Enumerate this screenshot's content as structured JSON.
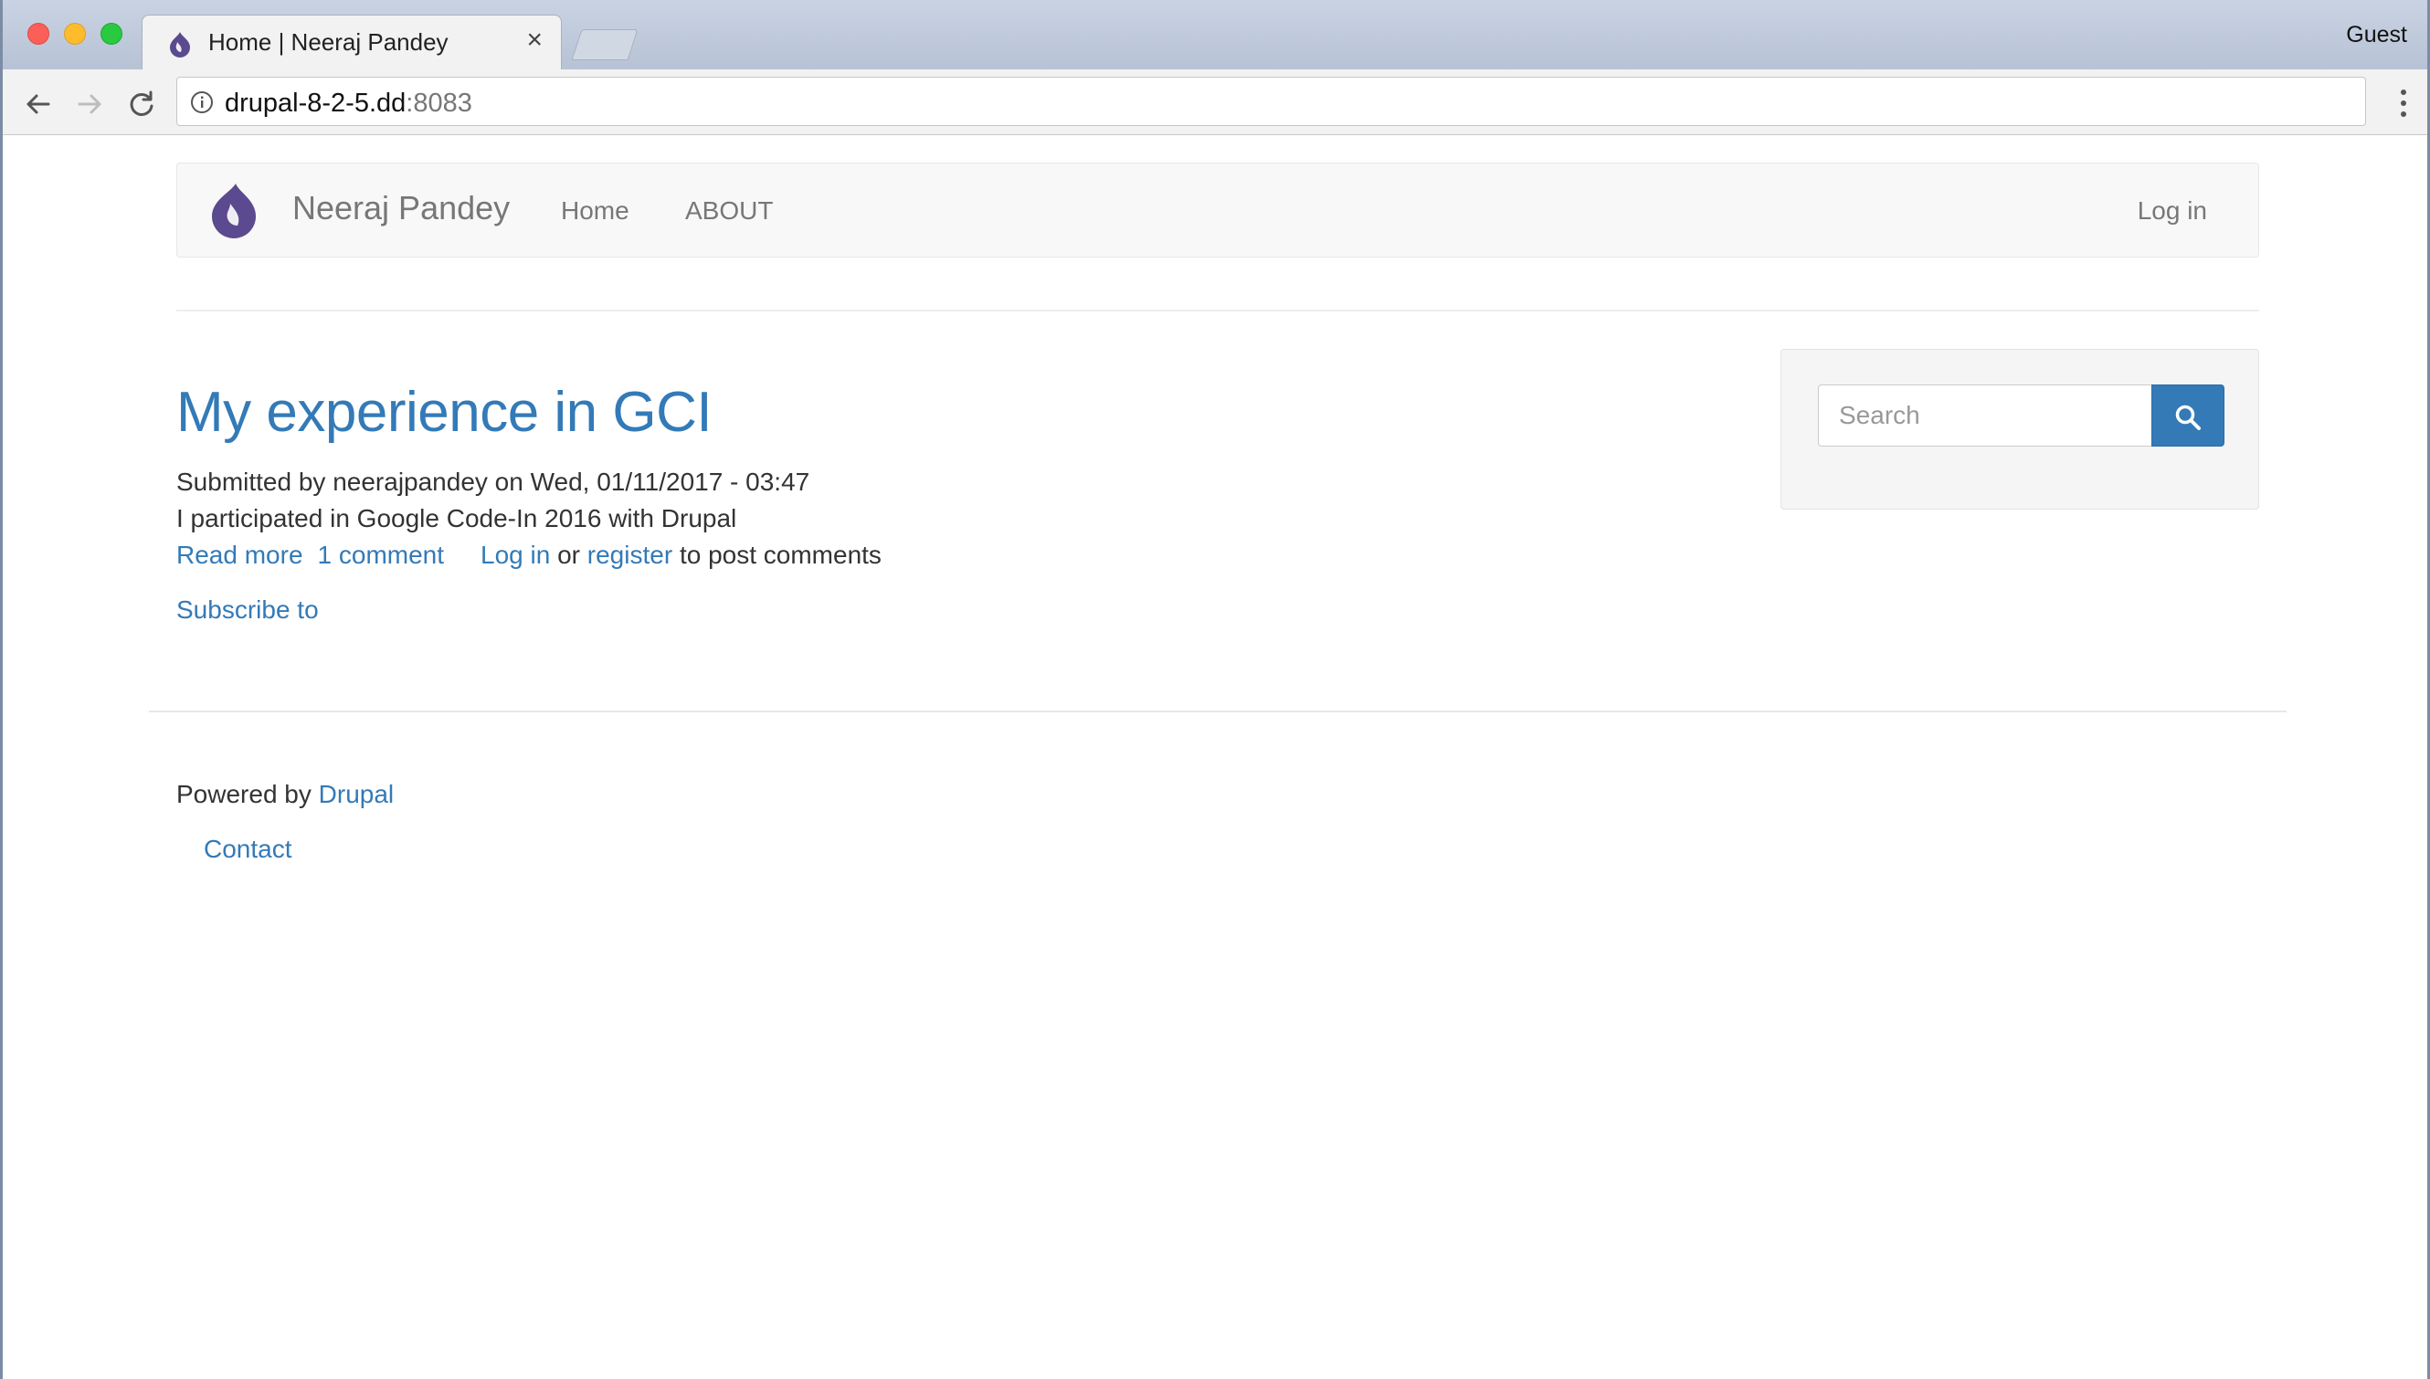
{
  "browser": {
    "tab_title": "Home | Neeraj Pandey",
    "tab_close": "×",
    "profile": "Guest",
    "url_host": "drupal-8-2-5.dd",
    "url_port": ":8083"
  },
  "header": {
    "site_name": "Neeraj Pandey",
    "nav": {
      "home": "Home",
      "about": "ABOUT",
      "login": "Log in"
    }
  },
  "article": {
    "title": "My experience in GCI",
    "submitted": "Submitted by neerajpandey on Wed, 01/11/2017 - 03:47",
    "summary": "I participated in Google Code-In 2016 with Drupal",
    "read_more": "Read more",
    "comments": "1 comment",
    "login": "Log in",
    "or": "or",
    "register": "register",
    "post_comments": "to post comments",
    "subscribe": "Subscribe to"
  },
  "sidebar": {
    "search_placeholder": "Search"
  },
  "footer": {
    "powered_by": "Powered by",
    "drupal": "Drupal",
    "contact": "Contact"
  },
  "colors": {
    "link": "#337ab7",
    "drupal_logo": "#5b4a8f"
  },
  "icons": {
    "tab_favicon": "drupal-drop-icon",
    "site_logo": "drupal-drop-icon",
    "search_button": "magnifier-icon"
  }
}
